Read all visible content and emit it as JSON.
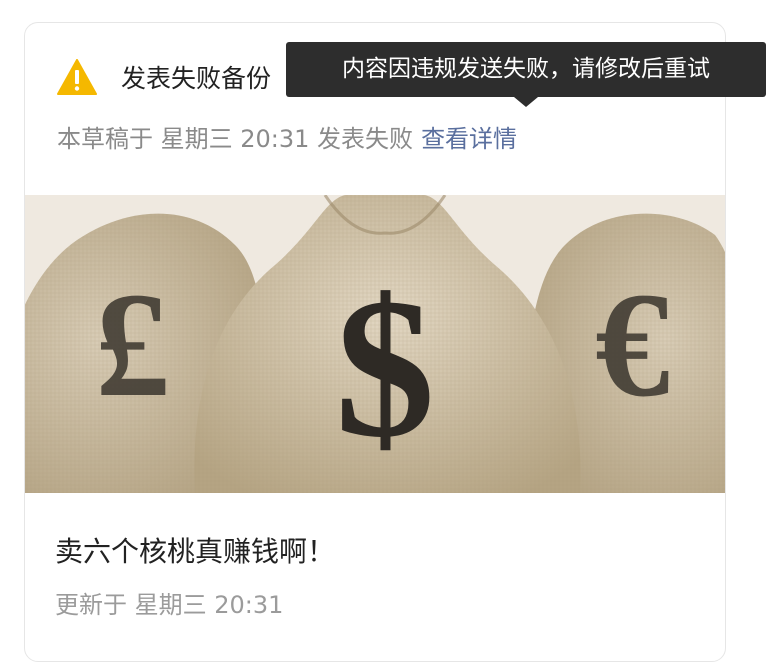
{
  "card": {
    "header_title": "发表失败备份",
    "meta_text": "本草稿于 星期三 20:31 发表失败",
    "meta_link": "查看详情",
    "post_title": "卖六个核桃真赚钱啊！",
    "post_time": "更新于 星期三 20:31"
  },
  "tooltip": {
    "text": "内容因违规发送失败，请修改后重试"
  },
  "cover_symbols": {
    "left": "£",
    "center": "$",
    "right": "€"
  },
  "colors": {
    "warning": "#f5b800",
    "link": "#5a6f9e",
    "tooltip_bg": "#2d2d2d",
    "sack": "#cdbfa6"
  },
  "icons": {
    "warning": "warning-triangle-icon"
  }
}
